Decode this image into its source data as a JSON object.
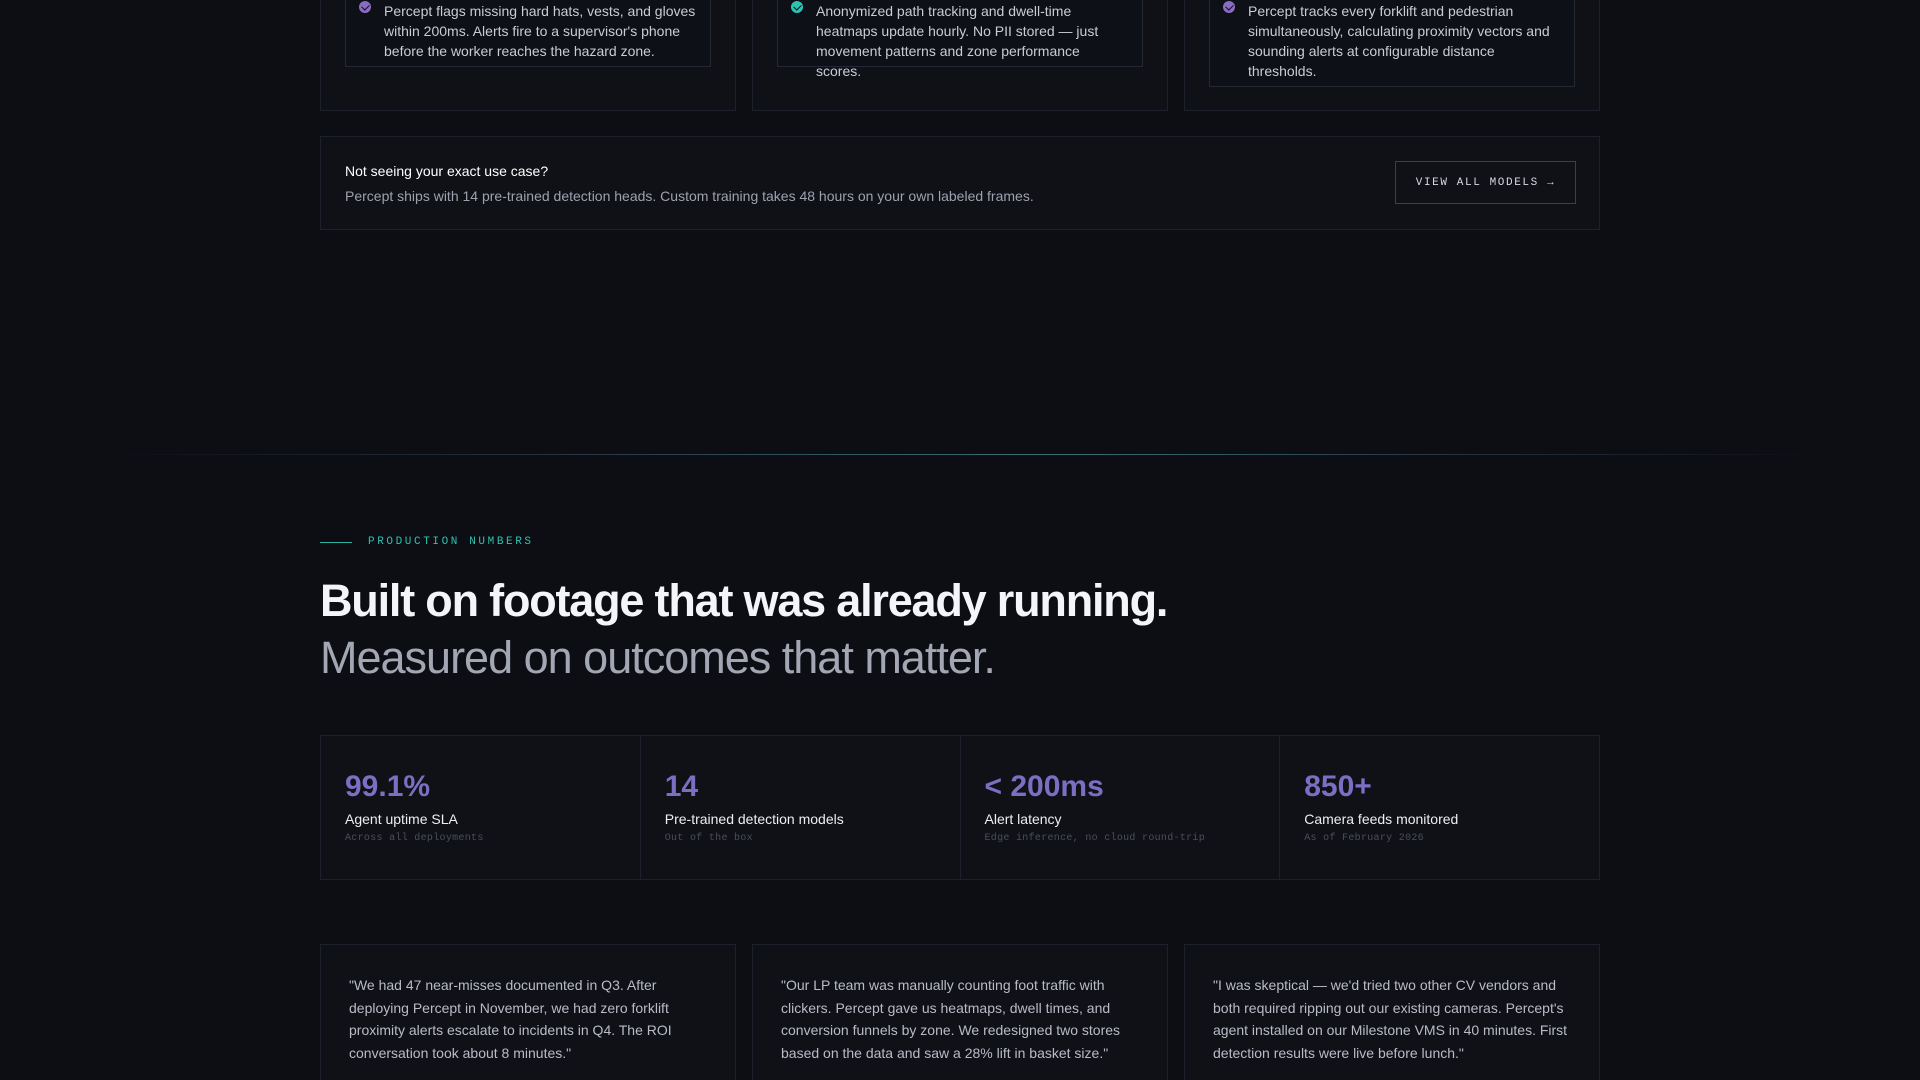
{
  "use_cases": [
    {
      "text": "Percept flags missing hard hats, vests, and gloves within 200ms. Alerts fire to a supervisor's phone before the worker reaches the hazard zone.",
      "check_icon": "check-circle-icon",
      "color": "#8a6cc4"
    },
    {
      "text": "Anonymized path tracking and dwell-time heatmaps update hourly. No PII stored — just movement patterns and zone performance scores.",
      "check_icon": "check-circle-icon",
      "color": "#2bc4b2"
    },
    {
      "text": "Percept tracks every forklift and pedestrian simultaneously, calculating proximity vectors and sounding alerts at configurable distance thresholds.",
      "check_icon": "check-circle-icon",
      "color": "#8a6cc4"
    }
  ],
  "banner": {
    "title": "Not seeing your exact use case?",
    "description": "Percept ships with 14 pre-trained detection heads. Custom training takes 48 hours on your own labeled frames.",
    "button_label": "VIEW ALL MODELS →"
  },
  "section": {
    "eyebrow": "PRODUCTION NUMBERS",
    "headline": "Built on footage that was already running.",
    "subheadline": "Measured on outcomes that matter."
  },
  "stats": [
    {
      "value": "99.1%",
      "label": "Agent uptime SLA",
      "sub": "Across all deployments"
    },
    {
      "value": "14",
      "label": "Pre-trained detection models",
      "sub": "Out of the box"
    },
    {
      "value": "< 200ms",
      "label": "Alert latency",
      "sub": "Edge inference, no cloud round-trip"
    },
    {
      "value": "850+",
      "label": "Camera feeds monitored",
      "sub": "As of February 2026"
    }
  ],
  "testimonials": [
    {
      "quote": "\"We had 47 near-misses documented in Q3. After deploying Percept in November, we had zero forklift proximity alerts escalate to incidents in Q4. The ROI conversation took about 8 minutes.\""
    },
    {
      "quote": "\"Our LP team was manually counting foot traffic with clickers. Percept gave us heatmaps, dwell times, and conversion funnels by zone. We redesigned two stores based on the data and saw a 28% lift in basket size.\""
    },
    {
      "quote": "\"I was skeptical — we'd tried two other CV vendors and both required ripping out our existing cameras. Percept's agent installed on our Milestone VMS in 40 minutes. First detection results were live before lunch.\""
    }
  ],
  "colors": {
    "accent_purple": "#7b6fc4",
    "accent_teal": "#2bc4b2",
    "background": "#0c0e13"
  }
}
